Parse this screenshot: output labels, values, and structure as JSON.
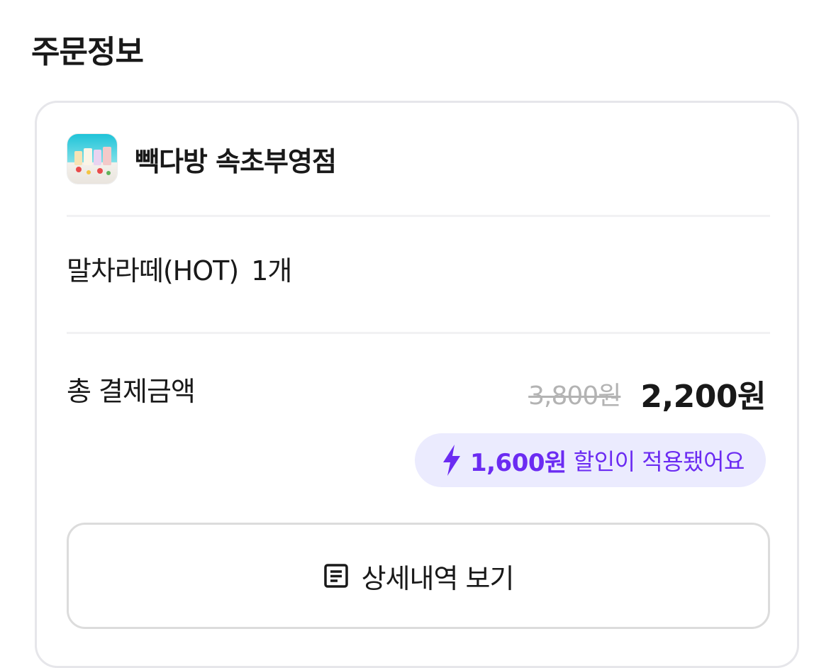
{
  "section": {
    "title": "주문정보"
  },
  "store": {
    "name": "빽다방 속초부영점",
    "thumbnail_icon": "store-thumbnail"
  },
  "order": {
    "item_name": "말차라떼(HOT)",
    "quantity": "1개"
  },
  "payment": {
    "total_label": "총 결제금액",
    "original_price": "3,800원",
    "final_price": "2,200원"
  },
  "discount": {
    "icon": "lightning-icon",
    "amount": "1,600원",
    "text": "할인이 적용됐어요"
  },
  "detail_button": {
    "icon": "receipt-list-icon",
    "label": "상세내역 보기"
  },
  "colors": {
    "accent": "#6b2bf2",
    "pill_background": "#ebebfe",
    "strikethrough": "#b3b3b3",
    "border": "#e6e6ea"
  }
}
